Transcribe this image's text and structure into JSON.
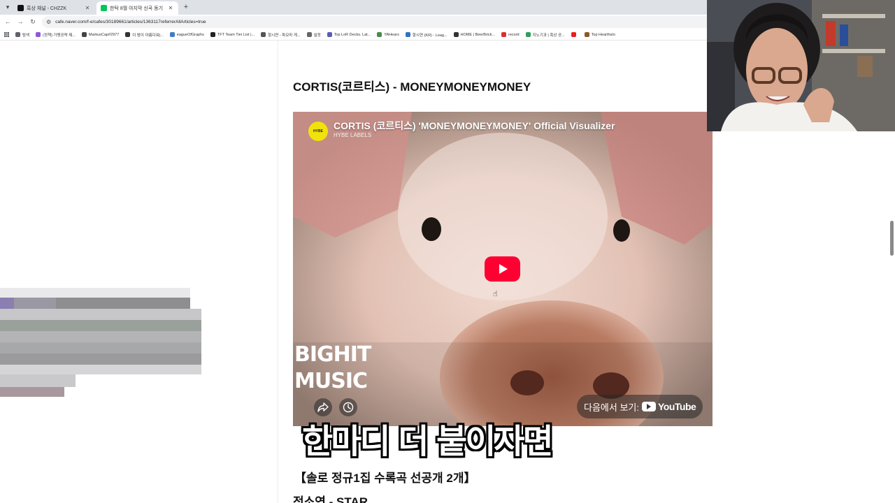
{
  "tabs": [
    {
      "label": "흑상 채널 - CHZZK",
      "favicon_color": "#111111",
      "active": false
    },
    {
      "label": "한탁 8월 아지막 신곡 동기",
      "favicon_color": "#03c75a",
      "active": true
    }
  ],
  "address": {
    "url": "cafe.naver.com/f-e/cafes/30189661/articles/1363117referrerAllArticles=true"
  },
  "bookmarks": [
    {
      "label": "탐색",
      "color": "#5f6368"
    },
    {
      "label": "(정책) 가맹공략 제...",
      "color": "#8c59d9"
    },
    {
      "label": "MarkusCap#2977",
      "color": "#444444"
    },
    {
      "label": "이 밤이 아름다워|...",
      "color": "#333333"
    },
    {
      "label": "eagueOfGraphs",
      "color": "#3e7dc2"
    },
    {
      "label": "TFT Team Tier List |...",
      "color": "#222222"
    },
    {
      "label": "항시연 - 파오마 게...",
      "color": "#555555"
    },
    {
      "label": "설정",
      "color": "#666666"
    },
    {
      "label": "Top LoR Decks. Lat...",
      "color": "#5b5bb5"
    },
    {
      "label": "YAHears",
      "color": "#4a8a4a"
    },
    {
      "label": "항시연 (KR) - Leag...",
      "color": "#2f74c0"
    },
    {
      "label": "HOME | BeerBrick...",
      "color": "#333333"
    },
    {
      "label": "record",
      "color": "#d93030"
    },
    {
      "label": "지노기과 | 흑상 공...",
      "color": "#2da05a"
    },
    {
      "label": "",
      "color": "#e62117"
    },
    {
      "label": "Top Hearthsto",
      "color": "#8a5a2a"
    }
  ],
  "article": {
    "title": "CORTIS(코르티스) - MONEYMONEYMONEY",
    "video": {
      "title": "CORTIS (코르티스) 'MONEYMONEYMONEY' Official Visualizer",
      "channel": "HYBE LABELS",
      "avatar_text": "HYBE",
      "label_line1": "BIGHIT",
      "label_line2": "MUSIC",
      "watch_on": "다음에서 보기:",
      "youtube": "YouTube"
    },
    "overlay_subtitle": "한마디 더 붙이자면",
    "section_heading": "【솔로 정규1집 수록곡 선공개 2개】",
    "subsection": "전소연 - STAR"
  },
  "icons": [
    "menu-chevron-icon",
    "back-arrow-icon",
    "forward-arrow-icon",
    "reload-icon",
    "tune-icon",
    "apps-grid-icon",
    "share-icon",
    "clock-icon",
    "play-icon",
    "hand-cursor-icon"
  ],
  "colors": {
    "tab_strip": "#dee1e6",
    "youtube_red": "#ff0033",
    "hybe_yellow": "#f1e20c"
  }
}
